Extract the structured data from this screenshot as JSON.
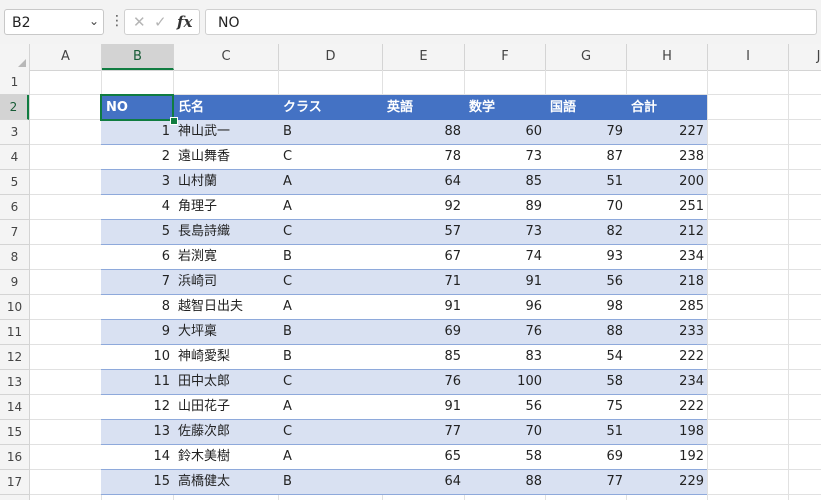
{
  "formula_bar": {
    "name_box": "B2",
    "formula": "NO",
    "fx_label": "fx"
  },
  "columns": [
    "A",
    "B",
    "C",
    "D",
    "E",
    "F",
    "G",
    "H",
    "I",
    "J"
  ],
  "rows": [
    "1",
    "2",
    "3",
    "4",
    "5",
    "6",
    "7",
    "8",
    "9",
    "10",
    "11",
    "12",
    "13",
    "14",
    "15",
    "16",
    "17"
  ],
  "table": {
    "headers": [
      "NO",
      "氏名",
      "クラス",
      "英語",
      "数学",
      "国語",
      "合計"
    ],
    "rows": [
      [
        "1",
        "神山武一",
        "B",
        "88",
        "60",
        "79",
        "227"
      ],
      [
        "2",
        "遠山舞香",
        "C",
        "78",
        "73",
        "87",
        "238"
      ],
      [
        "3",
        "山村蘭",
        "A",
        "64",
        "85",
        "51",
        "200"
      ],
      [
        "4",
        "角理子",
        "A",
        "92",
        "89",
        "70",
        "251"
      ],
      [
        "5",
        "長島詩織",
        "C",
        "57",
        "73",
        "82",
        "212"
      ],
      [
        "6",
        "岩渕寛",
        "B",
        "67",
        "74",
        "93",
        "234"
      ],
      [
        "7",
        "浜崎司",
        "C",
        "71",
        "91",
        "56",
        "218"
      ],
      [
        "8",
        "越智日出夫",
        "A",
        "91",
        "96",
        "98",
        "285"
      ],
      [
        "9",
        "大坪稟",
        "B",
        "69",
        "76",
        "88",
        "233"
      ],
      [
        "10",
        "神崎愛梨",
        "B",
        "85",
        "83",
        "54",
        "222"
      ],
      [
        "11",
        "田中太郎",
        "C",
        "76",
        "100",
        "58",
        "234"
      ],
      [
        "12",
        "山田花子",
        "A",
        "91",
        "56",
        "75",
        "222"
      ],
      [
        "13",
        "佐藤次郎",
        "C",
        "77",
        "70",
        "51",
        "198"
      ],
      [
        "14",
        "鈴木美樹",
        "A",
        "65",
        "58",
        "69",
        "192"
      ],
      [
        "15",
        "高橋健太",
        "B",
        "64",
        "88",
        "77",
        "229"
      ]
    ]
  },
  "colors": {
    "header_fill": "#4472c4",
    "band_fill": "#d9e1f2",
    "selection": "#107c41"
  }
}
